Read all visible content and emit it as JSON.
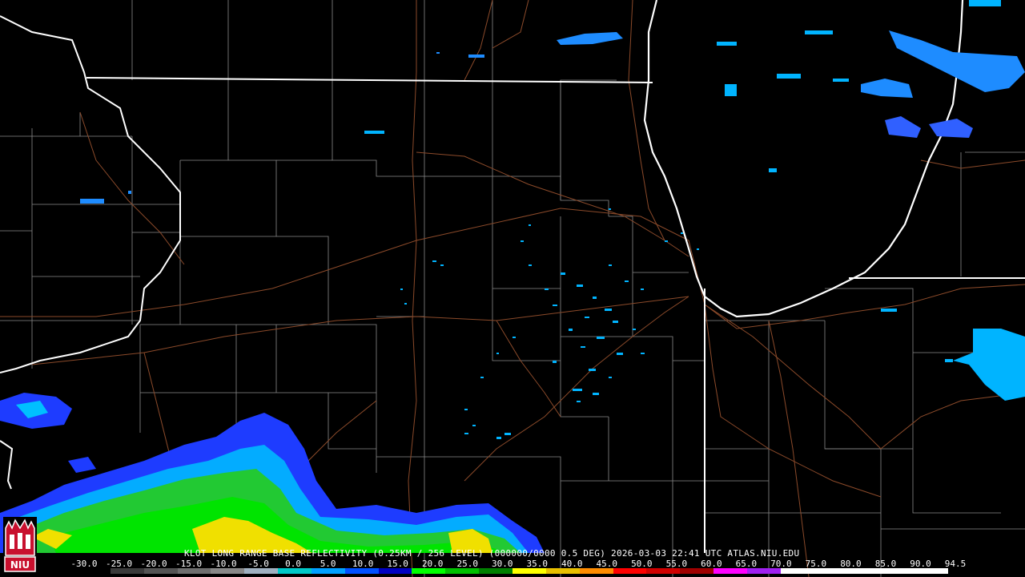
{
  "caption": {
    "product": "KLOT LONG RANGE BASE REFLECTIVITY (0.25KM / 256 LEVEL) (000000/0000 0.5 DEG) 2026-03-03 22:41 UTC  ATLAS.NIU.EDU"
  },
  "legend": {
    "ticks": [
      "-30.0",
      "-25.0",
      "-20.0",
      "-15.0",
      "-10.0",
      "-5.0",
      "0.0",
      "5.0",
      "10.0",
      "15.0",
      "20.0",
      "25.0",
      "30.0",
      "35.0",
      "40.0",
      "45.0",
      "50.0",
      "55.0",
      "60.0",
      "65.0",
      "70.0",
      "75.0",
      "80.0",
      "85.0",
      "90.0",
      "94.5"
    ],
    "colors": [
      "#000000",
      "#3a3a3a",
      "#545454",
      "#6e6e6e",
      "#888888",
      "#9fb0c0",
      "#00c8c8",
      "#00a0ff",
      "#0050ff",
      "#0000c0",
      "#00ff00",
      "#00c000",
      "#008000",
      "#ffff00",
      "#e8c000",
      "#ff8c00",
      "#ff0000",
      "#d00000",
      "#a00000",
      "#ff00ff",
      "#a020f0",
      "#ffffff",
      "#ffffff",
      "#ffffff",
      "#ffffff",
      "#ffffff"
    ]
  },
  "logo": {
    "text": "NIU"
  }
}
